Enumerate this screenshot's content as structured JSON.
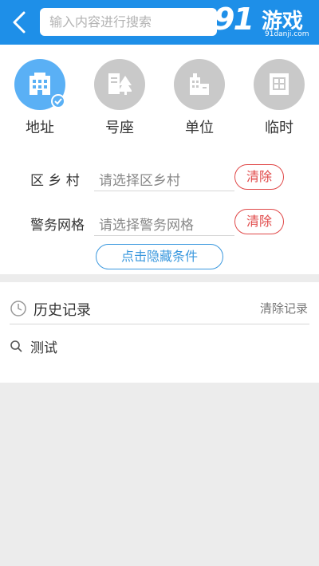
{
  "header": {
    "search_placeholder": "输入内容进行搜索",
    "watermark": {
      "big": "91",
      "game": "游戏",
      "site": "91danji.com"
    }
  },
  "categories": [
    {
      "label": "地址",
      "icon": "building-icon",
      "active": true
    },
    {
      "label": "号座",
      "icon": "house-tree-icon",
      "active": false
    },
    {
      "label": "单位",
      "icon": "office-building-icon",
      "active": false
    },
    {
      "label": "临时",
      "icon": "window-icon",
      "active": false
    }
  ],
  "filters": [
    {
      "label": "区 乡 村",
      "placeholder": "请选择区乡村",
      "clear": "清除"
    },
    {
      "label": "警务网格",
      "placeholder": "请选择警务网格",
      "clear": "清除"
    }
  ],
  "toggle_label": "点击隐藏条件",
  "history": {
    "title": "历史记录",
    "clear_label": "清除记录",
    "items": [
      "测试"
    ]
  },
  "colors": {
    "header": "#1e8fe8",
    "active": "#5ab0f5",
    "inactive": "#c9c9c9",
    "danger": "#e04848",
    "link": "#3a98de"
  }
}
